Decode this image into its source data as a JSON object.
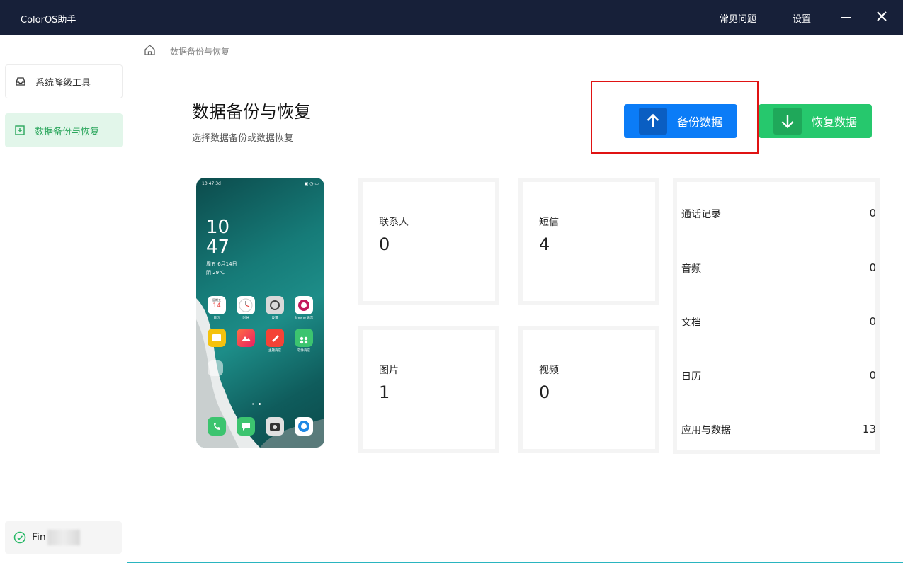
{
  "app": {
    "title": "ColorOS助手"
  },
  "titlebar": {
    "faq": "常见问题",
    "settings": "设置"
  },
  "sidebar": {
    "items": [
      {
        "label": "系统降级工具",
        "icon": "inbox-icon",
        "active": false
      },
      {
        "label": "数据备份与恢复",
        "icon": "backup-icon",
        "active": true
      }
    ],
    "device": {
      "name_visible": "Fin",
      "status": "connected"
    }
  },
  "breadcrumb": {
    "label": "数据备份与恢复"
  },
  "main": {
    "title": "数据备份与恢复",
    "subtitle": "选择数据备份或数据恢复",
    "backup_button": "备份数据",
    "restore_button": "恢复数据"
  },
  "phone": {
    "status_time": "10:47",
    "status_extra": "3d",
    "clock_hour": "10",
    "clock_minute": "47",
    "date_line": "周五 6月14日",
    "weather_line": "阴 29℃",
    "calendar_week": "星期五",
    "calendar_day": "14",
    "apps_row1": [
      "日历",
      "时钟",
      "设置",
      "Breeno 语音"
    ],
    "apps_row2": [
      "",
      "",
      "主题商店",
      "软件商店"
    ]
  },
  "stats": {
    "cards": [
      {
        "label": "联系人",
        "value": "0"
      },
      {
        "label": "短信",
        "value": "4"
      },
      {
        "label": "图片",
        "value": "1"
      },
      {
        "label": "视频",
        "value": "0"
      }
    ],
    "list": [
      {
        "label": "通话记录",
        "value": "0"
      },
      {
        "label": "音频",
        "value": "0"
      },
      {
        "label": "文档",
        "value": "0"
      },
      {
        "label": "日历",
        "value": "0"
      },
      {
        "label": "应用与数据",
        "value": "13"
      }
    ]
  },
  "colors": {
    "titlebar": "#172039",
    "backup": "#0b7cf7",
    "restore": "#26c86d",
    "active_nav_bg": "#e2f6ea",
    "highlight": "#e01313"
  }
}
